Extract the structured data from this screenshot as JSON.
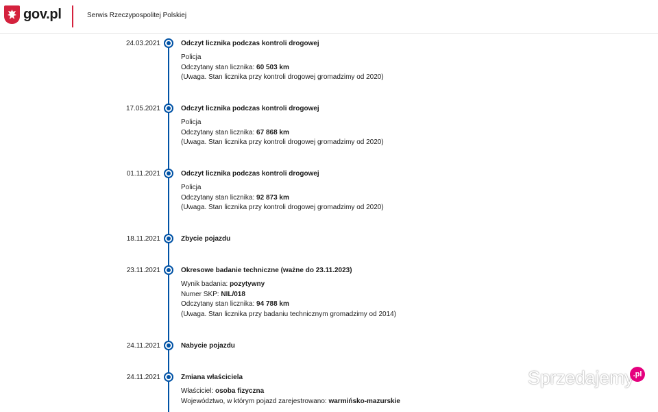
{
  "header": {
    "brand": "gov.pl",
    "service": "Serwis Rzeczypospolitej Polskiej",
    "colors": {
      "accent_red": "#d4213d",
      "timeline_blue": "#0052a5"
    }
  },
  "events": [
    {
      "date": "24.03.2021",
      "title": "Odczyt licznika podczas kontroli drogowej",
      "source": "Policja",
      "mileage_label": "Odczytany stan licznika:",
      "mileage_value": "60 503 km",
      "note": "(Uwaga. Stan licznika przy kontroli drogowej gromadzimy od 2020)"
    },
    {
      "date": "17.05.2021",
      "title": "Odczyt licznika podczas kontroli drogowej",
      "source": "Policja",
      "mileage_label": "Odczytany stan licznika:",
      "mileage_value": "67 868 km",
      "note": "(Uwaga. Stan licznika przy kontroli drogowej gromadzimy od 2020)"
    },
    {
      "date": "01.11.2021",
      "title": "Odczyt licznika podczas kontroli drogowej",
      "source": "Policja",
      "mileage_label": "Odczytany stan licznika:",
      "mileage_value": "92 873 km",
      "note": "(Uwaga. Stan licznika przy kontroli drogowej gromadzimy od 2020)"
    },
    {
      "date": "18.11.2021",
      "title": "Zbycie pojazdu"
    },
    {
      "date": "23.11.2021",
      "title": "Okresowe badanie techniczne (ważne do 23.11.2023)",
      "result_label": "Wynik badania:",
      "result_value": "pozytywny",
      "skp_label": "Numer SKP:",
      "skp_value": "NIL/018",
      "mileage_label": "Odczytany stan licznika:",
      "mileage_value": "94 788 km",
      "note": "(Uwaga. Stan licznika przy badaniu technicznym gromadzimy od 2014)"
    },
    {
      "date": "24.11.2021",
      "title": "Nabycie pojazdu"
    },
    {
      "date": "24.11.2021",
      "title": "Zmiana właściciela",
      "owner_label": "Właściciel:",
      "owner_value": "osoba fizyczna",
      "region_label": "Województwo, w którym pojazd zarejestrowano:",
      "region_value": "warmińsko-mazurskie"
    }
  ],
  "watermark": {
    "text": "Sprzedajemy",
    "badge": ".pl"
  }
}
